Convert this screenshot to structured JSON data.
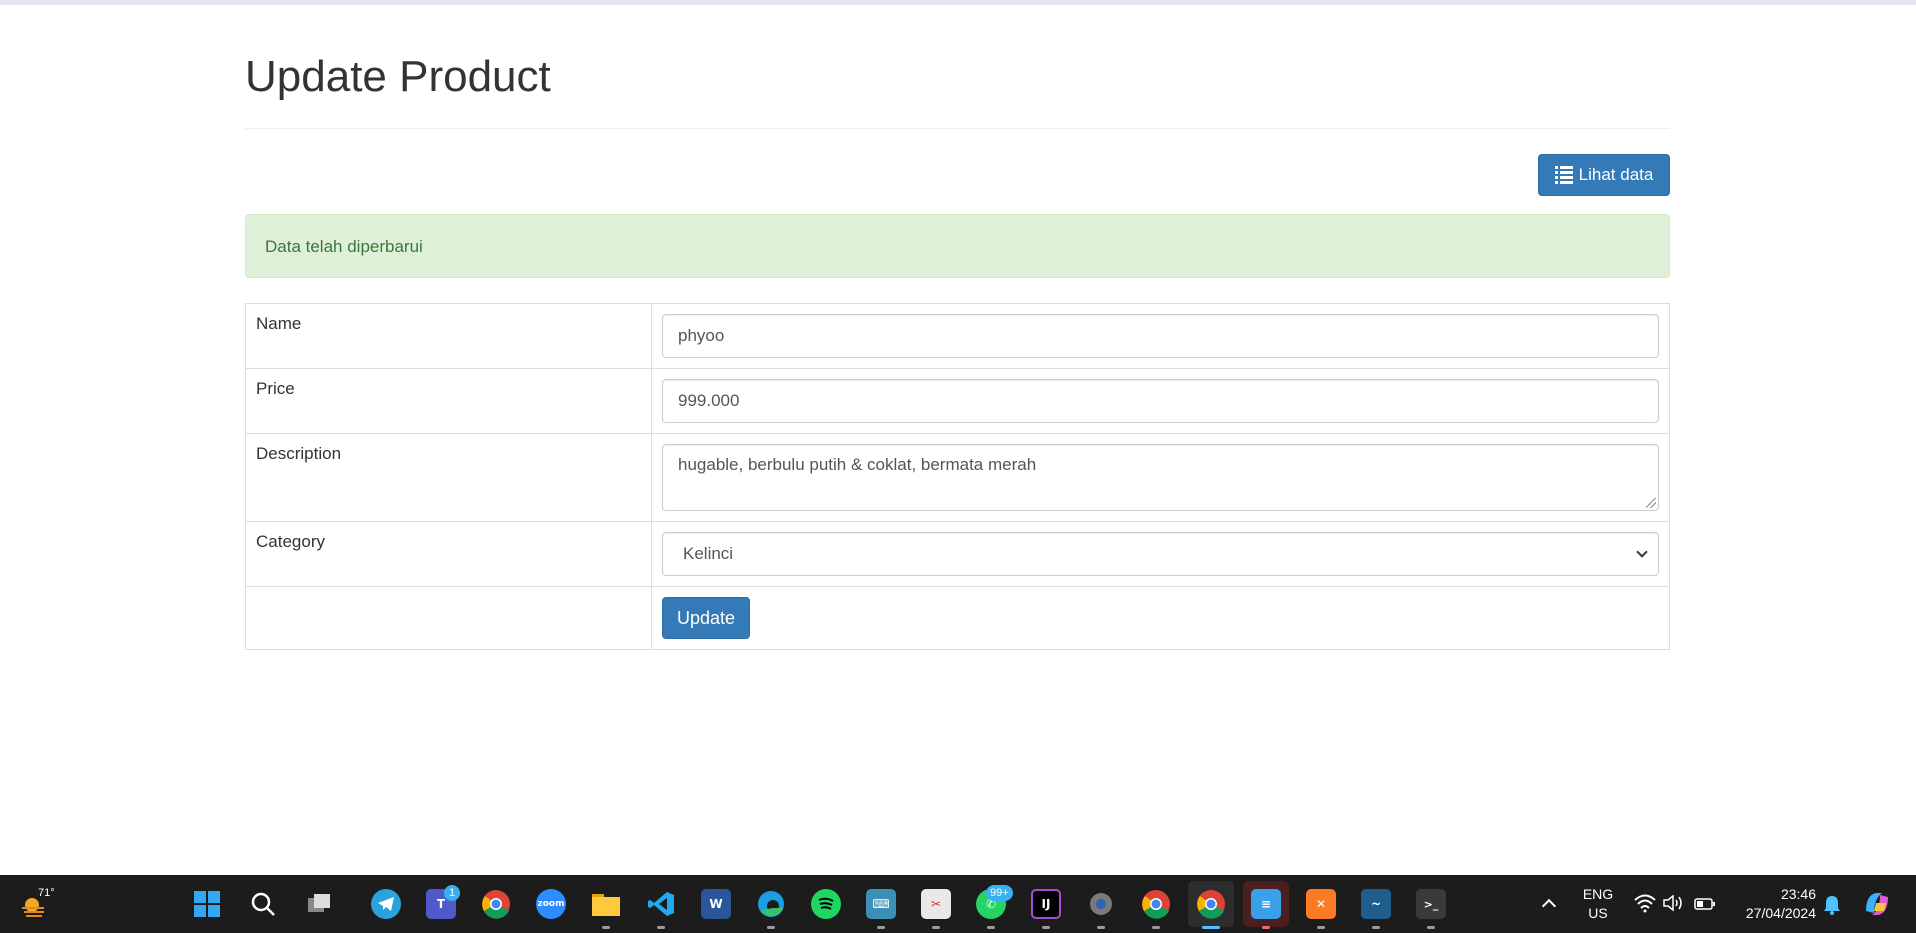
{
  "page": {
    "title": "Update Product",
    "view_button_label": "Lihat data",
    "alert_message": "Data telah diperbarui"
  },
  "form": {
    "name_label": "Name",
    "name_value": "phyoo",
    "price_label": "Price",
    "price_value": "999.000",
    "description_label": "Description",
    "description_value": "hugable, berbulu putih & coklat, bermata merah",
    "category_label": "Category",
    "category_selected": "Kelinci",
    "submit_label": "Update"
  },
  "taskbar": {
    "weather_temp": "71°",
    "teams_badge": "1",
    "whatsapp_badge": "99+",
    "zoom_label": "zoom",
    "language_line1": "ENG",
    "language_line2": "US",
    "time": "23:46",
    "date": "27/04/2024",
    "apps": [
      "start-icon",
      "search-icon",
      "task-view-icon",
      "telegram-icon",
      "teams-icon",
      "chrome-icon",
      "zoom-icon",
      "file-explorer-icon",
      "vscode-icon",
      "word-icon",
      "edge-icon",
      "spotify-icon",
      "keyboard-app-icon",
      "snipping-tool-icon",
      "whatsapp-icon",
      "intellij-icon",
      "settings-icon",
      "chrome-profile-icon",
      "chrome-active-icon",
      "notepad-icon",
      "xampp-icon",
      "mysql-workbench-icon",
      "terminal-icon"
    ]
  },
  "colors": {
    "primary": "#337ab7",
    "alert_bg": "#dff0d8",
    "alert_text": "#3c763d",
    "taskbar_bg": "#1c1c1c"
  }
}
